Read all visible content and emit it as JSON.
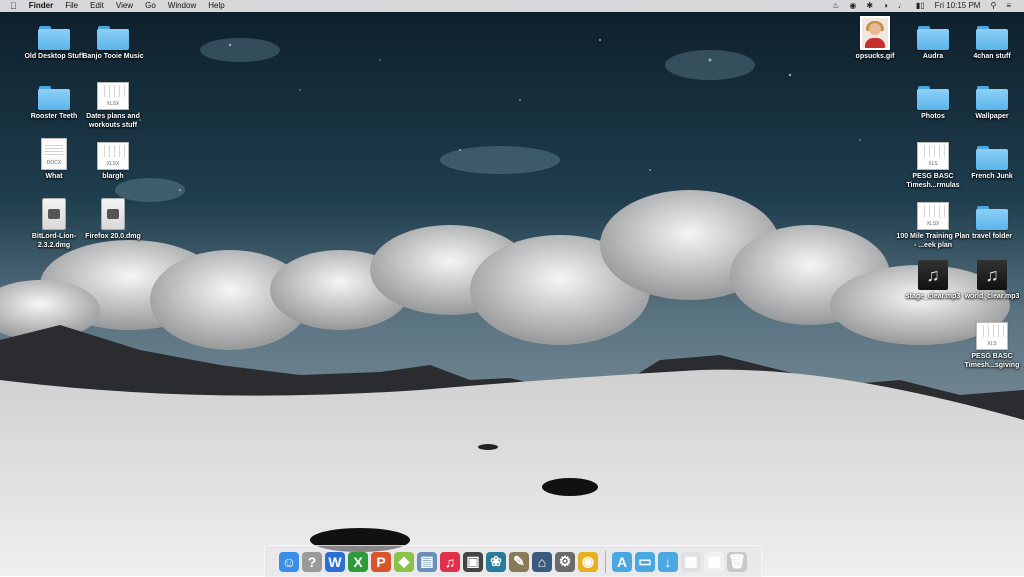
{
  "menubar": {
    "apple": "",
    "items": [
      "Finder",
      "File",
      "Edit",
      "View",
      "Go",
      "Window",
      "Help"
    ],
    "status": {
      "clock": "Fri 10:15 PM",
      "icons": [
        "notification-bell-icon",
        "camera-icon",
        "bluetooth-icon",
        "wifi-icon",
        "volume-icon",
        "battery-icon",
        "search-icon",
        "list-icon"
      ]
    }
  },
  "desktop": {
    "icons": [
      {
        "label": "Old Desktop Stuff",
        "kind": "folder"
      },
      {
        "label": "Banjo Tooie Music",
        "kind": "folder"
      },
      {
        "label": "Rooster Teeth",
        "kind": "folder"
      },
      {
        "label": "Dates plans and workouts stuff",
        "kind": "sheet",
        "tag": "XLSX"
      },
      {
        "label": "What",
        "kind": "doc",
        "tag": "DOCX"
      },
      {
        "label": "blargh",
        "kind": "sheet",
        "tag": "XLSX"
      },
      {
        "label": "BitLord-Lion-2.3.2.dmg",
        "kind": "dmg"
      },
      {
        "label": "Firefox 20.0.dmg",
        "kind": "dmg"
      },
      {
        "label": "opsucks.gif",
        "kind": "photo"
      },
      {
        "label": "Audra",
        "kind": "folder"
      },
      {
        "label": "4chan stuff",
        "kind": "folder"
      },
      {
        "label": "Photos",
        "kind": "folder"
      },
      {
        "label": "Wallpaper",
        "kind": "folder"
      },
      {
        "label": "PESG BASC Timesh...rmulas",
        "kind": "sheet",
        "tag": "XLS"
      },
      {
        "label": "French Junk",
        "kind": "folder"
      },
      {
        "label": "100 Mile Training Plan - ...eek plan",
        "kind": "sheet",
        "tag": "XLSX"
      },
      {
        "label": "travel folder",
        "kind": "folder"
      },
      {
        "label": "stage_clear.mp3",
        "kind": "music"
      },
      {
        "label": "world_clear.mp3",
        "kind": "music"
      },
      {
        "label": "PESG BASC Timesh...sgiving",
        "kind": "sheet",
        "tag": "XLS"
      }
    ]
  },
  "dock": {
    "apps": [
      {
        "icon": "finder-icon",
        "glyph": "☺",
        "color": "#3b8ee8"
      },
      {
        "icon": "help-icon",
        "glyph": "?",
        "color": "#9a9a9a"
      },
      {
        "icon": "word-icon",
        "glyph": "W",
        "color": "#2a6fd1"
      },
      {
        "icon": "excel-icon",
        "glyph": "X",
        "color": "#2f9a3a"
      },
      {
        "icon": "powerpoint-icon",
        "glyph": "P",
        "color": "#d9542b"
      },
      {
        "icon": "android-icon",
        "glyph": "◆",
        "color": "#8bc34a"
      },
      {
        "icon": "preview-icon",
        "glyph": "▤",
        "color": "#6a8fb8"
      },
      {
        "icon": "itunes-icon",
        "glyph": "♫",
        "color": "#e0304a"
      },
      {
        "icon": "photo-booth-icon",
        "glyph": "▣",
        "color": "#444"
      },
      {
        "icon": "photos-icon",
        "glyph": "❀",
        "color": "#2a7a9a"
      },
      {
        "icon": "gimp-icon",
        "glyph": "✎",
        "color": "#8a7a5a"
      },
      {
        "icon": "home-icon",
        "glyph": "⌂",
        "color": "#3a5a80"
      },
      {
        "icon": "system-preferences-icon",
        "glyph": "⚙",
        "color": "#6a6a6a"
      },
      {
        "icon": "chrome-icon",
        "glyph": "◉",
        "color": "#e8b020"
      }
    ],
    "stacks": [
      {
        "icon": "applications-stack-icon",
        "glyph": "A",
        "color": "#4aa8e0"
      },
      {
        "icon": "documents-stack-icon",
        "glyph": "▭",
        "color": "#4aa8e0"
      },
      {
        "icon": "downloads-stack-icon",
        "glyph": "↓",
        "color": "#4aa8e0"
      },
      {
        "icon": "recent-items-stack-icon",
        "glyph": "▦",
        "color": "#e0e0e0"
      },
      {
        "icon": "recent-files-stack-icon",
        "glyph": "▦",
        "color": "#f0f0f0"
      },
      {
        "icon": "trash-icon",
        "glyph": "🗑",
        "color": "#c8c8c8"
      }
    ]
  }
}
